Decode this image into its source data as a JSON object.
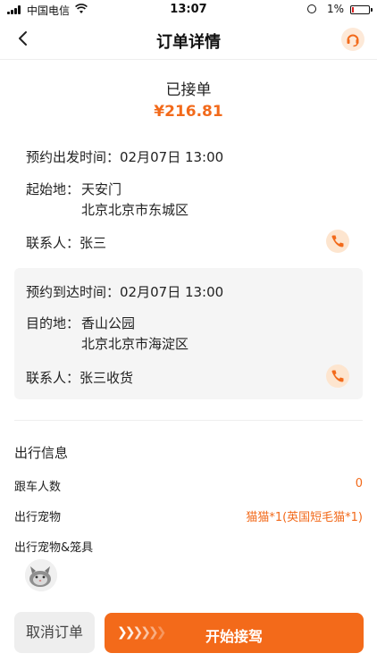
{
  "status_bar": {
    "carrier": "中国电信",
    "time": "13:07",
    "battery": "1%",
    "battery_level": 0.01
  },
  "nav": {
    "title": "订单详情",
    "back_icon": "chevron-left-icon",
    "service_icon": "headset-icon"
  },
  "order": {
    "status": "已接单",
    "price": "¥216.81"
  },
  "pickup": {
    "time_label": "预约出发时间：",
    "time": "02月07日 13:00",
    "origin_label": "起始地：",
    "origin_name": "天安门",
    "origin_address": "北京北京市东城区",
    "contact_label": "联系人：",
    "contact_name": "张三"
  },
  "dropoff": {
    "time_label": "预约到达时间：",
    "time": "02月07日 13:00",
    "dest_label": "目的地：",
    "dest_name": "香山公园",
    "dest_address": "北京北京市海淀区",
    "contact_label": "联系人：",
    "contact_name": "张三收货"
  },
  "trip_info": {
    "title": "出行信息",
    "riders_label": "跟车人数",
    "riders_value": "0",
    "pets_label": "出行宠物",
    "pets_value": "猫猫*1(英国短毛猫*1)",
    "pets_cage_label": "出行宠物&笼具"
  },
  "actions": {
    "cancel": "取消订单",
    "start": "开始接驾"
  },
  "colors": {
    "accent": "#f36a1a",
    "accent_light": "#fde5cf"
  }
}
